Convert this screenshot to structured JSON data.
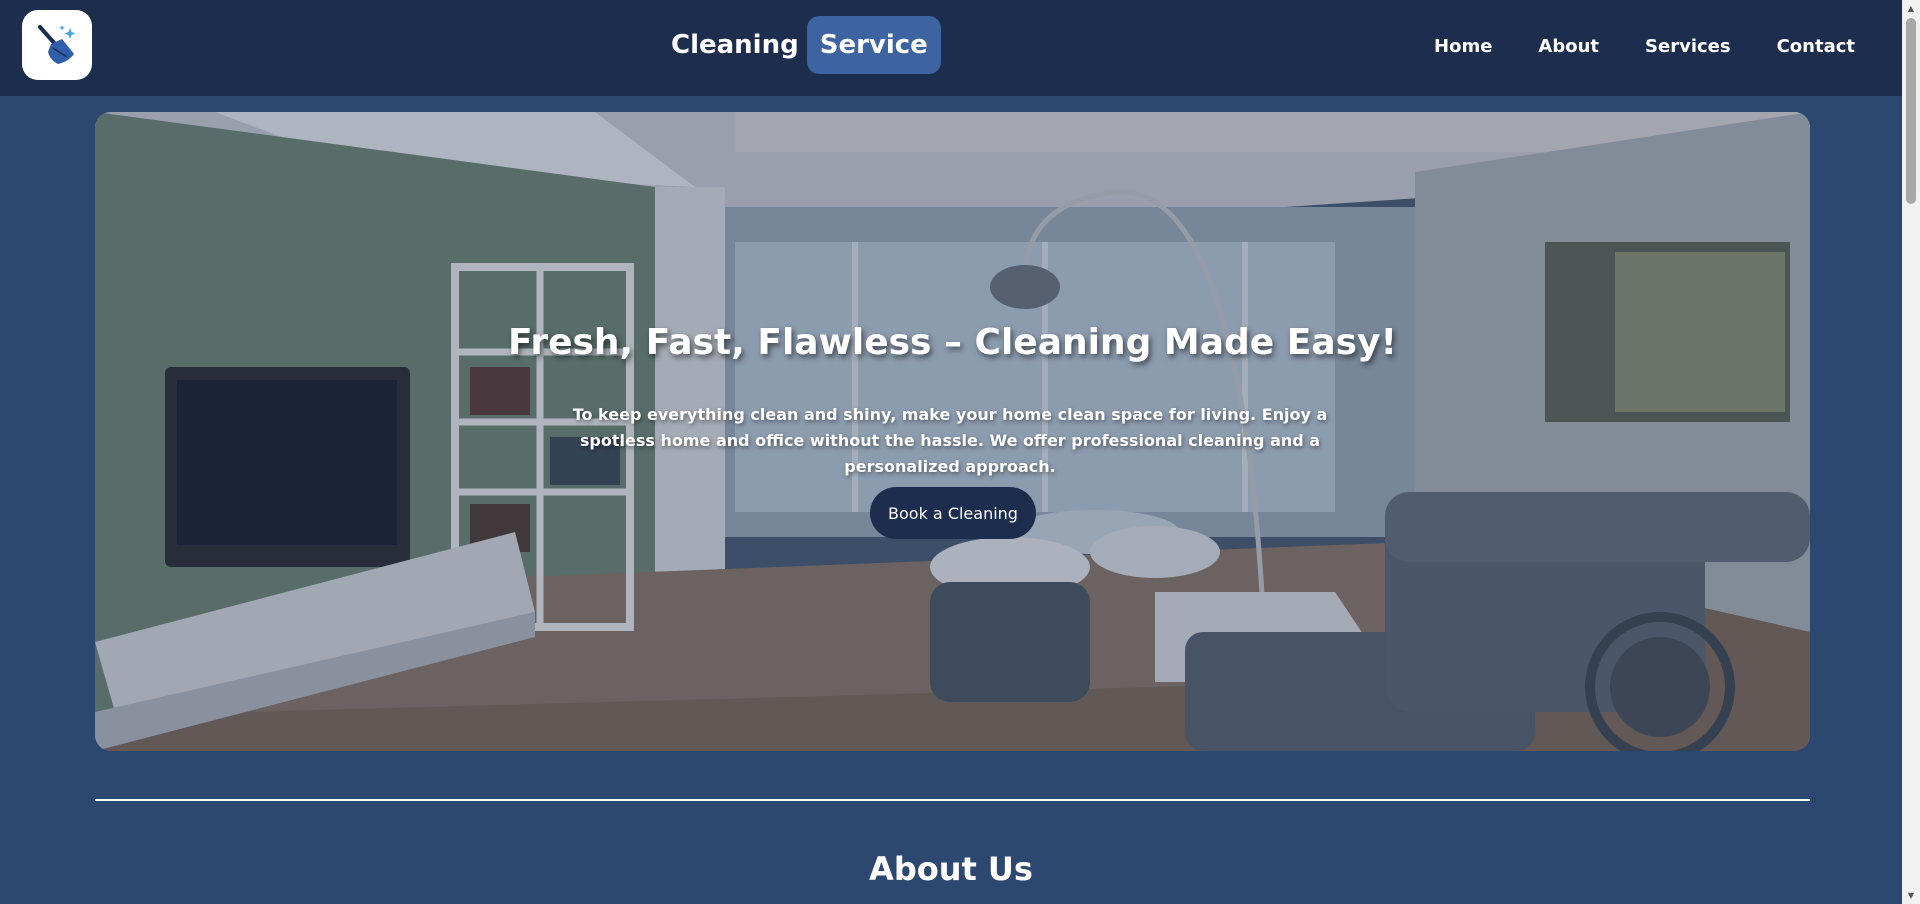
{
  "header": {
    "brand_word": "Cleaning",
    "brand_highlight": "Service",
    "logo_icon": "broom-sparkle-icon",
    "nav": [
      {
        "label": "Home"
      },
      {
        "label": "About"
      },
      {
        "label": "Services"
      },
      {
        "label": "Contact"
      }
    ]
  },
  "hero": {
    "title": "Fresh, Fast, Flawless – Cleaning Made Easy!",
    "text": "To keep everything clean and shiny, make your home clean space for living. Enjoy a spotless home and office without the hassle. We offer professional cleaning and a personalized approach.",
    "button_label": "Book a Cleaning"
  },
  "about": {
    "title": "About Us"
  },
  "colors": {
    "navbar": "#1c2d4d",
    "page": "#2c4770",
    "brand_pill": "#3d63a0",
    "button": "#1c2d4d"
  }
}
